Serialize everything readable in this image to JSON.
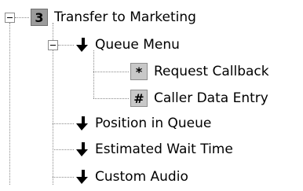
{
  "tree": {
    "root": {
      "badge": "3",
      "label": "Transfer to Marketing",
      "icon": "step-number-badge"
    },
    "children": [
      {
        "label": "Queue Menu",
        "icon": "return-arrow-icon",
        "expanded": true,
        "children": [
          {
            "key": "*",
            "label": "Request Callback",
            "icon": "star-key-icon"
          },
          {
            "key": "#",
            "label": "Caller Data Entry",
            "icon": "hash-key-icon"
          }
        ]
      },
      {
        "label": "Position in Queue",
        "icon": "return-arrow-icon"
      },
      {
        "label": "Estimated Wait Time",
        "icon": "return-arrow-icon"
      },
      {
        "label": "Custom Audio",
        "icon": "return-arrow-icon"
      }
    ]
  },
  "colors": {
    "connector": "#8a8a8a",
    "badge_bg": "#9c9c9c",
    "key_bg": "#c8c8c8",
    "text": "#000000"
  }
}
